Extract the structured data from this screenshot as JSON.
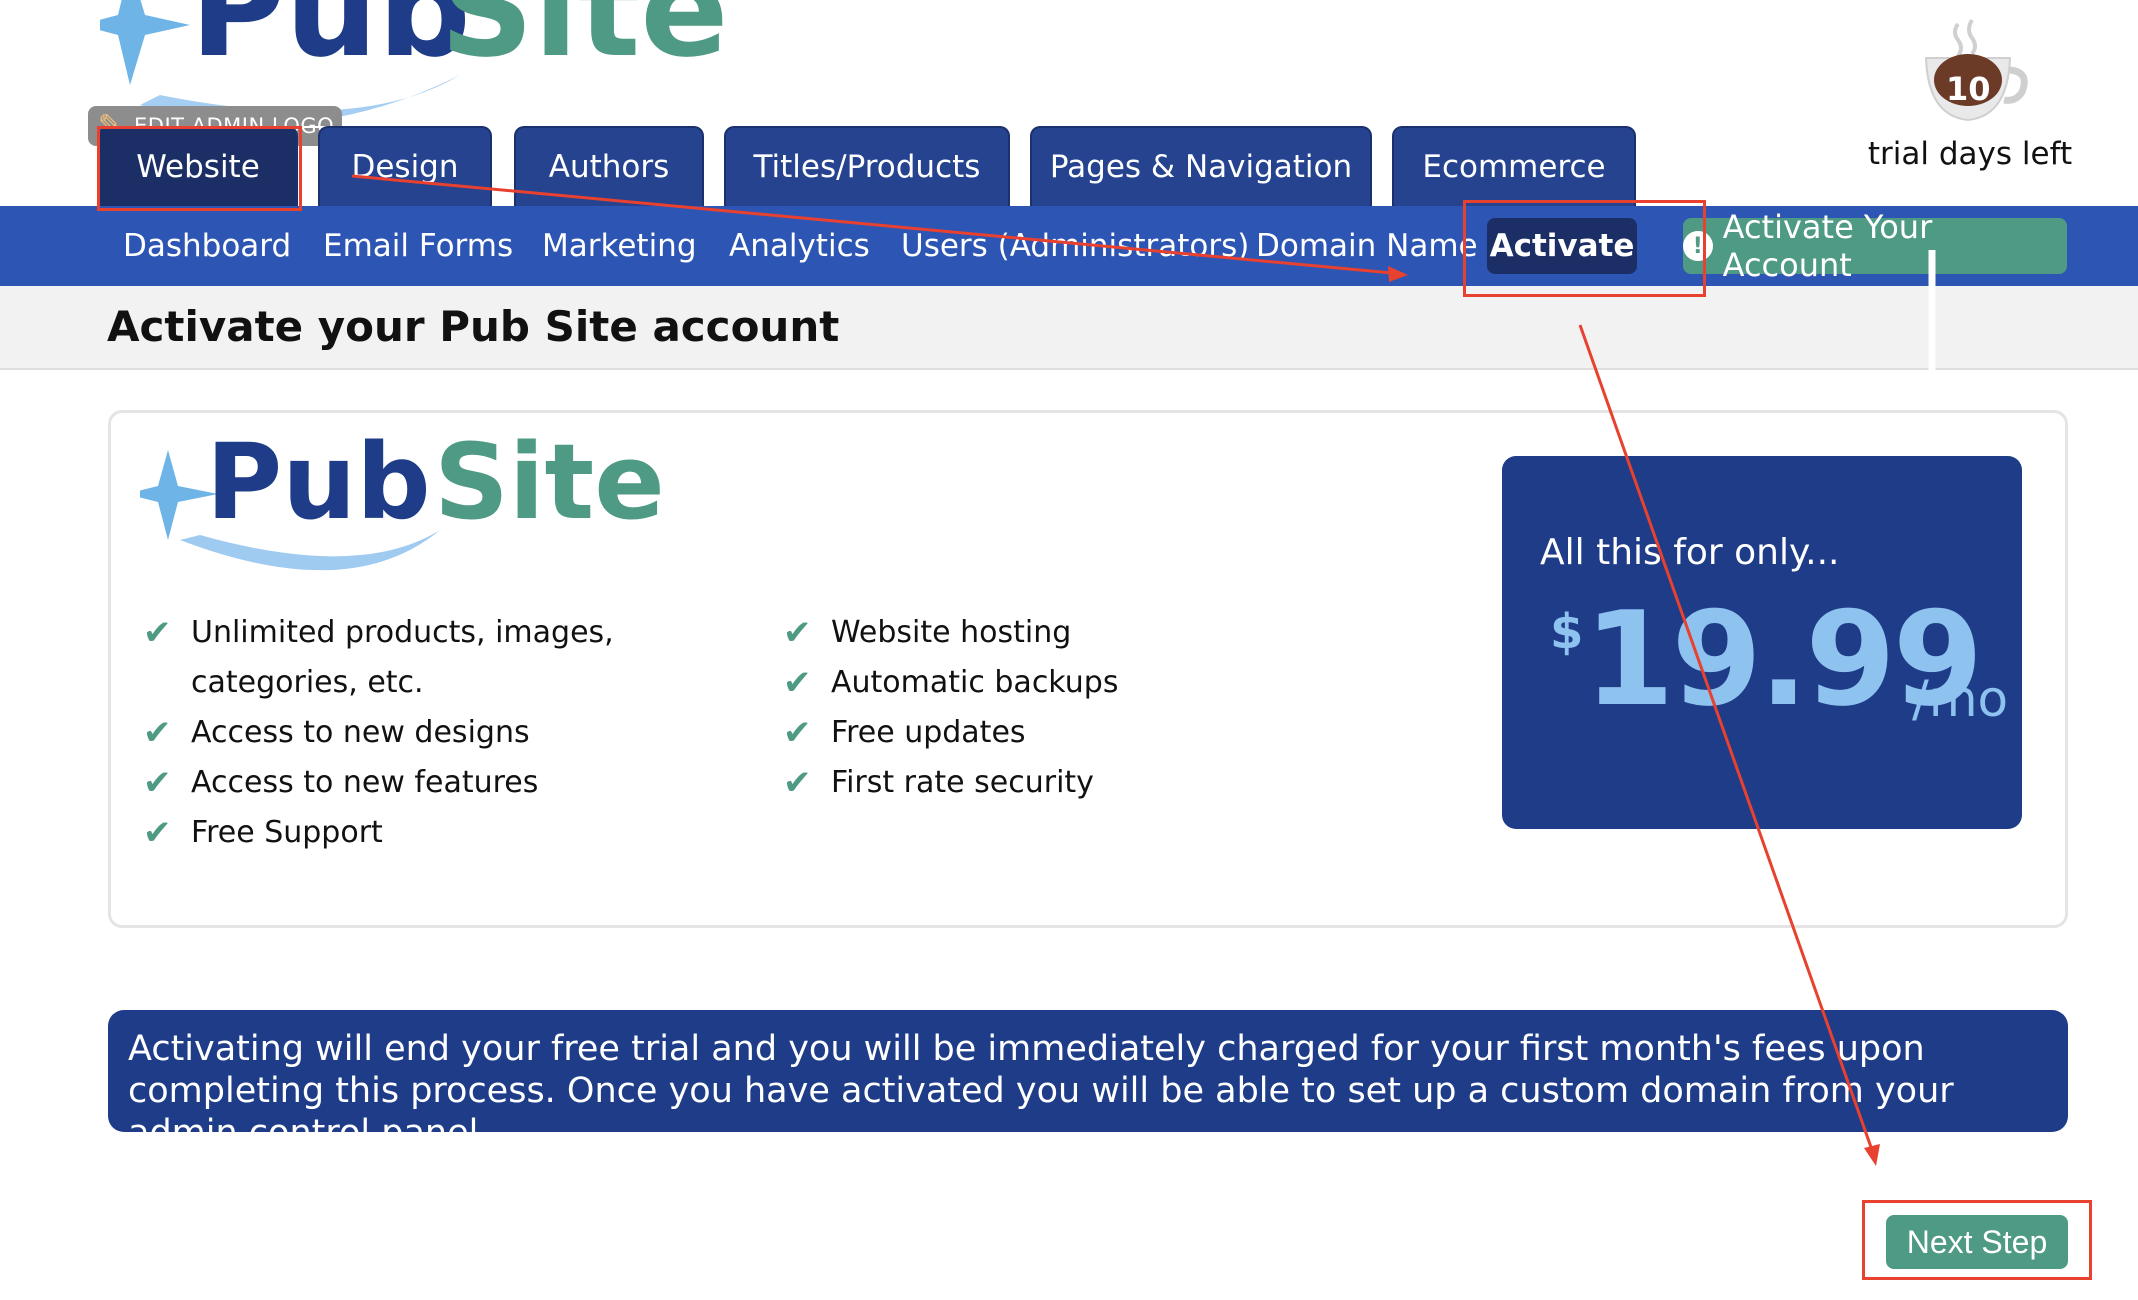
{
  "header": {
    "logo": {
      "part1": "Pub",
      "part2": "Site"
    },
    "edit_logo_label": "EDIT ADMIN LOGO",
    "trial_days": "10",
    "trial_label": "trial days left"
  },
  "tabs": [
    {
      "label": "Website"
    },
    {
      "label": "Design"
    },
    {
      "label": "Authors"
    },
    {
      "label": "Titles/Products"
    },
    {
      "label": "Pages & Navigation"
    },
    {
      "label": "Ecommerce"
    }
  ],
  "subnav": {
    "items": [
      {
        "label": "Dashboard"
      },
      {
        "label": "Email Forms"
      },
      {
        "label": "Marketing"
      },
      {
        "label": "Analytics"
      },
      {
        "label": "Users (Administrators)"
      },
      {
        "label": "Domain Name"
      }
    ],
    "active_label": "Activate",
    "activate_account_label": "Activate Your Account",
    "alert_glyph": "!"
  },
  "page": {
    "title": "Activate your Pub Site account"
  },
  "card": {
    "logo": {
      "part1": "Pub",
      "part2": "Site"
    },
    "features_left": [
      "Unlimited products, images,",
      "categories, etc.",
      "Access to new designs",
      "Access to new features",
      "Free Support"
    ],
    "features_right": [
      "Website hosting",
      "Automatic backups",
      "Free updates",
      "First rate security"
    ],
    "price": {
      "label": "All this for only...",
      "currency": "$",
      "amount": "19.99",
      "unit": "/mo"
    }
  },
  "notice": {
    "text": "Activating will end your free trial and you will be immediately charged for your first month's fees upon completing this process. Once you have activated you will be able to set up a custom domain from your admin control panel."
  },
  "actions": {
    "next_label": "Next Step"
  },
  "colors": {
    "navy": "#25438f",
    "subnav_blue": "#2d55b3",
    "green": "#4f9a84",
    "price_blue": "#8ec2ef",
    "annotation_red": "#e8412f"
  }
}
